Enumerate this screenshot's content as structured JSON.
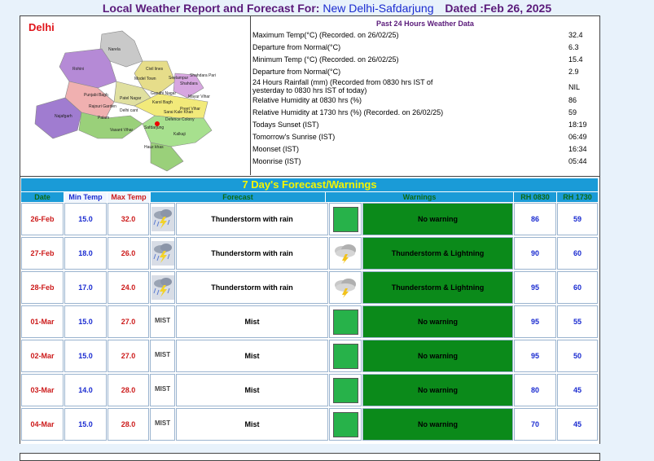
{
  "header": {
    "prefix": "Local Weather Report and Forecast For:",
    "station": "New Delhi-Safdarjung",
    "dated": "Dated :Feb 26, 2025"
  },
  "map": {
    "title": "Delhi",
    "labels": [
      "Narela",
      "Rohini",
      "Civil lines",
      "Shahdara",
      "Model Town",
      "Seelampur",
      "Shahdara Pari",
      "Punjabi Bagh",
      "Gandhi Nagar",
      "Rajouri Garden",
      "Patel Nagar",
      "Preet Vihar",
      "Mayur Vihar",
      "Delhi cant",
      "Najafgarh",
      "Palam",
      "Vasant Vihar",
      "Safdarjung",
      "Defence Colony",
      "Kalkaji",
      "Hauz khas",
      "Sarai Kale Khan",
      "Karol Bagh"
    ]
  },
  "past24": {
    "title": "Past 24 Hours Weather Data",
    "rows": [
      {
        "label": "Maximum Temp(°C) (Recorded. on 26/02/25)",
        "value": "32.4"
      },
      {
        "label": "Departure from Normal(°C)",
        "value": "6.3"
      },
      {
        "label": "Minimum Temp (°C) (Recorded. on 26/02/25)",
        "value": "15.4"
      },
      {
        "label": "Departure from Normal(°C)",
        "value": "2.9"
      },
      {
        "label": "24 Hours Rainfall (mm) (Recorded from 0830 hrs IST of yesterday to 0830 hrs IST of today)",
        "value": "NIL"
      },
      {
        "label": "Relative Humidity at 0830 hrs (%)",
        "value": "86"
      },
      {
        "label": "Relative Humidity at 1730 hrs (%) (Recorded. on 26/02/25)",
        "value": "59"
      },
      {
        "label": "Todays Sunset (IST)",
        "value": "18:19"
      },
      {
        "label": "Tomorrow's Sunrise (IST)",
        "value": "06:49"
      },
      {
        "label": "Moonset (IST)",
        "value": "16:34"
      },
      {
        "label": "Moonrise (IST)",
        "value": "05:44"
      }
    ]
  },
  "forecast": {
    "title": "7 Day's Forecast/Warnings",
    "headers": {
      "date": "Date",
      "min": "Min Temp",
      "max": "Max Temp",
      "forecast": "Forecast",
      "warnings": "Warnings",
      "rh0830": "RH 0830",
      "rh1730": "RH 1730"
    },
    "colors": {
      "header_bg": "#1a9bd7",
      "title_text": "#f5f500",
      "warning_bg": "#0b8a1a",
      "green_icon": "#27b24a"
    },
    "rows": [
      {
        "date": "26-Feb",
        "min": "15.0",
        "max": "32.0",
        "icon": "thunderstorm-rain-icon",
        "forecast": "Thunderstorm with rain",
        "warn_icon": "green-square",
        "warning": "No warning",
        "rh0830": "86",
        "rh1730": "59"
      },
      {
        "date": "27-Feb",
        "min": "18.0",
        "max": "26.0",
        "icon": "thunderstorm-rain-icon",
        "forecast": "Thunderstorm with rain",
        "warn_icon": "thunderstorm-lightning-icon",
        "warning": "Thunderstorm & Lightning",
        "rh0830": "90",
        "rh1730": "60"
      },
      {
        "date": "28-Feb",
        "min": "17.0",
        "max": "24.0",
        "icon": "thunderstorm-rain-icon",
        "forecast": "Thunderstorm with rain",
        "warn_icon": "thunderstorm-lightning-icon",
        "warning": "Thunderstorm & Lightning",
        "rh0830": "95",
        "rh1730": "60"
      },
      {
        "date": "01-Mar",
        "min": "15.0",
        "max": "27.0",
        "icon": "mist-icon",
        "icon_text": "MIST",
        "forecast": "Mist",
        "warn_icon": "green-square",
        "warning": "No warning",
        "rh0830": "95",
        "rh1730": "55"
      },
      {
        "date": "02-Mar",
        "min": "15.0",
        "max": "27.0",
        "icon": "mist-icon",
        "icon_text": "MIST",
        "forecast": "Mist",
        "warn_icon": "green-square",
        "warning": "No warning",
        "rh0830": "95",
        "rh1730": "50"
      },
      {
        "date": "03-Mar",
        "min": "14.0",
        "max": "28.0",
        "icon": "mist-icon",
        "icon_text": "MIST",
        "forecast": "Mist",
        "warn_icon": "green-square",
        "warning": "No warning",
        "rh0830": "80",
        "rh1730": "45"
      },
      {
        "date": "04-Mar",
        "min": "15.0",
        "max": "28.0",
        "icon": "mist-icon",
        "icon_text": "MIST",
        "forecast": "Mist",
        "warn_icon": "green-square",
        "warning": "No warning",
        "rh0830": "70",
        "rh1730": "45"
      }
    ]
  }
}
